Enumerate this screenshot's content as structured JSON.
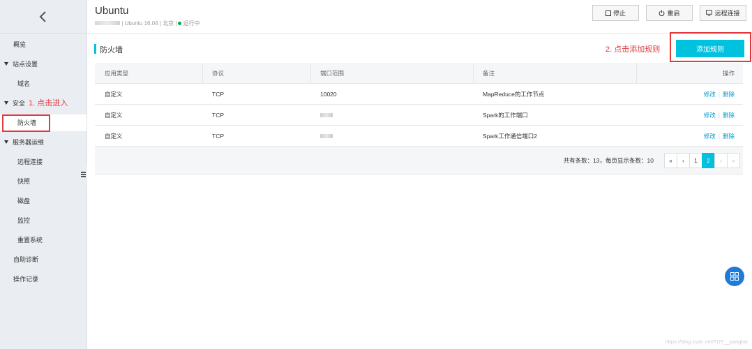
{
  "header": {
    "title": "Ubuntu",
    "sub_os": "Ubuntu 16.04",
    "sub_region": "北京",
    "sub_status": "运行中",
    "sep": "|",
    "buttons": {
      "stop": "停止",
      "restart": "重启",
      "remote": "远程连接"
    }
  },
  "sidebar": {
    "overview": "概览",
    "site_settings": "站点设置",
    "domain": "域名",
    "security": "安全",
    "firewall": "防火墙",
    "server_ops": "服务器运维",
    "remote_connect": "远程连接",
    "snapshot": "快照",
    "disk": "磁盘",
    "monitor": "监控",
    "reset_system": "重置系统",
    "self_diagnosis": "自助诊断",
    "operation_log": "操作记录"
  },
  "annotations": {
    "step1": "1. 点击进入",
    "step2": "2. 点击添加规则"
  },
  "section": {
    "title": "防火墙",
    "add_rule": "添加规则"
  },
  "table": {
    "headers": [
      "应用类型",
      "协议",
      "端口范围",
      "备注",
      "操作"
    ],
    "rows": [
      {
        "type": "自定义",
        "protocol": "TCP",
        "port": "10020",
        "note": "MapReduce的工作节点"
      },
      {
        "type": "自定义",
        "protocol": "TCP",
        "port": "",
        "note": "Spark的工作端口"
      },
      {
        "type": "自定义",
        "protocol": "TCP",
        "port": "",
        "note": "Spark工作通信端口2"
      }
    ],
    "edit_label": "修改",
    "delete_label": "删除",
    "action_sep": "|"
  },
  "pagination": {
    "summary": "共有条数：13，每页显示条数：10",
    "first": "«",
    "prev": "‹",
    "pages": [
      "1",
      "2"
    ],
    "current_page": "2",
    "next": "›",
    "last": "»"
  },
  "watermark": "https://blog.csdn.net/TUT__pangluk",
  "colors": {
    "accent": "#00c1de",
    "annotation_red": "#e4393c",
    "status_green": "#00a854",
    "link": "#0099cc"
  }
}
